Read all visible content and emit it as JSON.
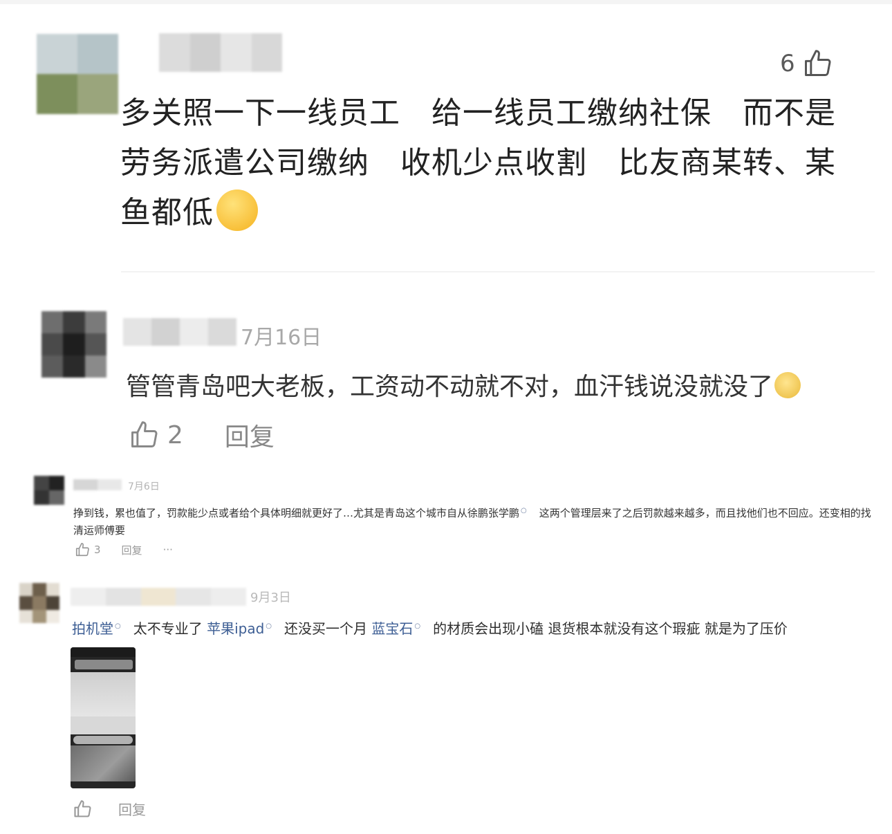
{
  "comments": [
    {
      "likes": "6",
      "text": "多关照一下一线员工　给一线员工缴纳社保　而不是劳务派遣公司缴纳　收机少点收割　比友商某转、某鱼都低"
    },
    {
      "date": "7月16日",
      "text": "管管青岛吧大老板，工资动不动就不对，血汗钱说没就没了",
      "likes": "2",
      "reply_label": "回复"
    },
    {
      "date": "7月6日",
      "text": "挣到钱，累也值了，罚款能少点或者给个具体明细就更好了…尤其是青岛这个城市自从徐鹏张学鹏",
      "text_tail": "这两个管理层来了之后罚款越来越多，而且找他们也不回应。还变相的找清运师傅要",
      "likes": "3",
      "reply_label": "回复",
      "more_label": "···"
    },
    {
      "date": "9月3日",
      "tag1": "拍机堂",
      "text_a": "太不专业了",
      "tag2": "苹果ipad",
      "text_b": "还没买一个月",
      "tag3": "蓝宝石",
      "text_c": "的材质会出现小磕 退货根本就没有这个瑕疵 就是为了压价",
      "reply_label": "回复"
    }
  ],
  "icons": {
    "like": "thumbs-up-icon",
    "search_marker": "search-link-icon",
    "emoji_facepalm": "facepalm-emoji",
    "emoji_crying": "crying-emoji"
  },
  "colors": {
    "link": "#3d5e94",
    "muted": "#999999",
    "text": "#222222"
  }
}
